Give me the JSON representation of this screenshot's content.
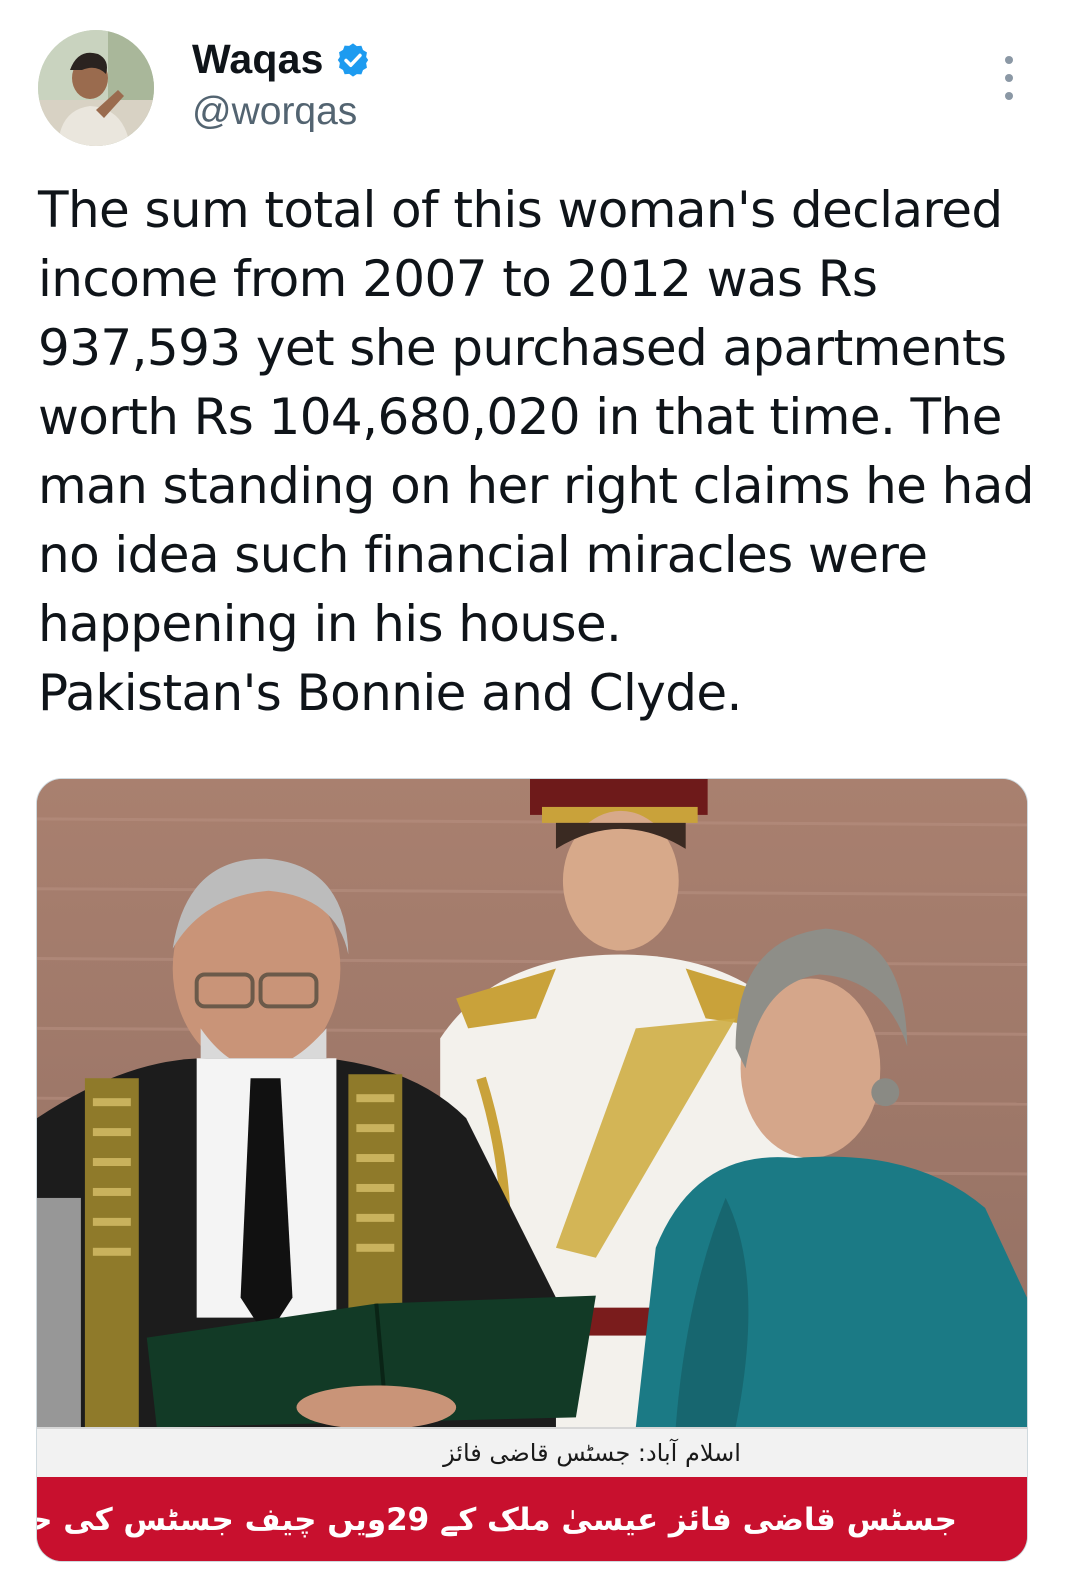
{
  "author": {
    "display_name": "Waqas",
    "handle": "@worqas",
    "verified": true,
    "verified_color": "#1d9bf0"
  },
  "tweet": {
    "lines": [
      "The sum total of this woman's declared",
      "income from 2007 to 2012 was Rs",
      "937,593 yet she purchased apartments",
      "worth Rs 104,680,020 in that time. The",
      "man standing on her right claims he had",
      "no idea such financial miracles were",
      "happening in his house.",
      "Pakistan's Bonnie and Clyde."
    ]
  },
  "media": {
    "ticker_top": "اسلام آباد: جسٹس قاضی فائز",
    "ticker_bottom": "جسٹس قاضی فائز عیسیٰ ملک کے 29ویں چیف جسٹس کی حیثیت سے حلف اٹھا رہے",
    "ticker_color": "#c8102e"
  },
  "icons": {
    "more": "more-options-icon",
    "verified": "verified-badge-icon"
  }
}
